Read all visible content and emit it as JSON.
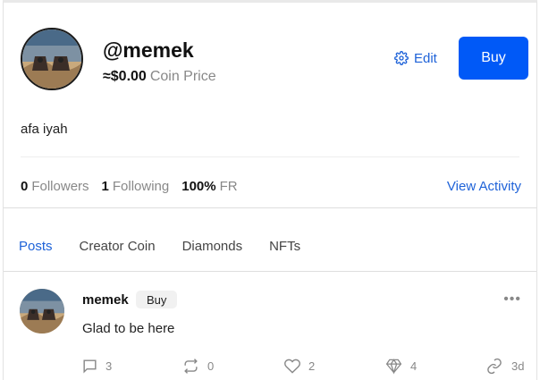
{
  "profile": {
    "username": "@memek",
    "coin_price_value": "≈$0.00",
    "coin_price_label": "Coin Price",
    "edit_label": "Edit",
    "buy_label": "Buy",
    "bio": "afa iyah",
    "stats": {
      "followers_count": "0",
      "followers_label": "Followers",
      "following_count": "1",
      "following_label": "Following",
      "fr_value": "100%",
      "fr_label": "FR"
    },
    "view_activity_label": "View Activity"
  },
  "tabs": [
    {
      "label": "Posts",
      "active": true
    },
    {
      "label": "Creator Coin",
      "active": false
    },
    {
      "label": "Diamonds",
      "active": false
    },
    {
      "label": "NFTs",
      "active": false
    }
  ],
  "post": {
    "author": "memek",
    "buy_label": "Buy",
    "more_label": "•••",
    "body": "Glad to be here",
    "actions": {
      "comments": "3",
      "reposts": "0",
      "likes": "2",
      "diamonds": "4",
      "age": "3d"
    }
  },
  "colors": {
    "accent": "#0059f7",
    "link": "#1e62d8",
    "muted": "#888888"
  }
}
